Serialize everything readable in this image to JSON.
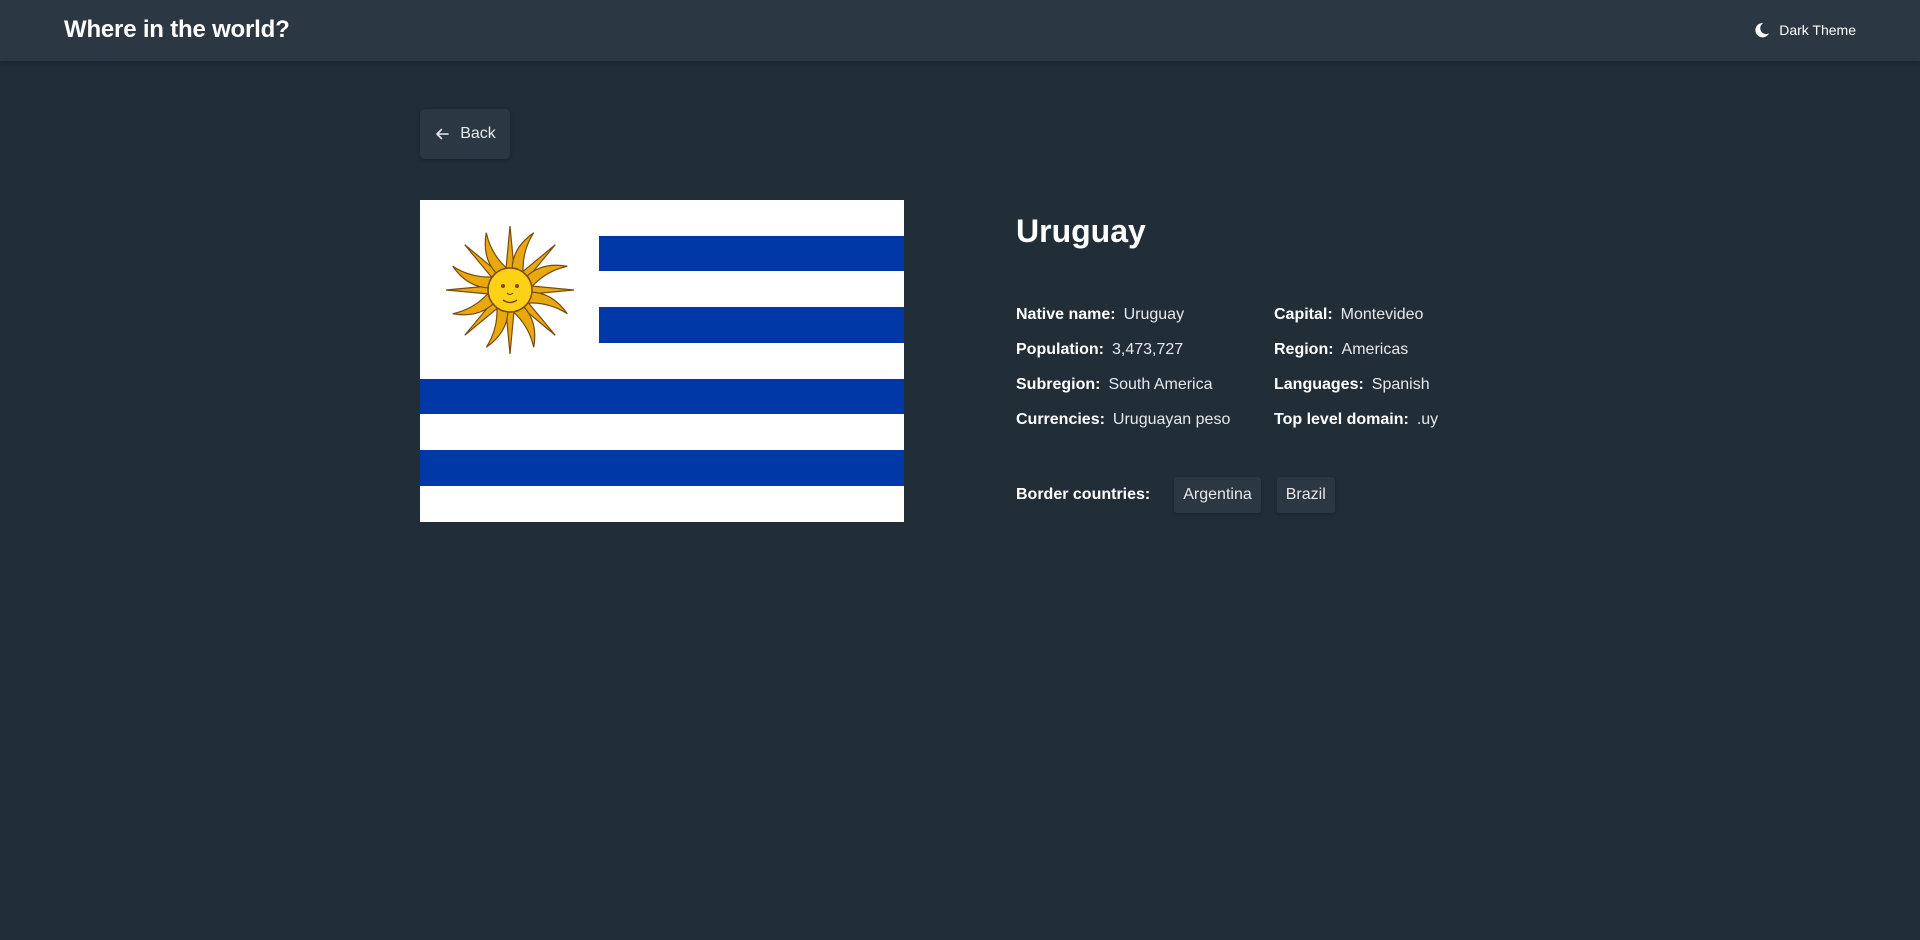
{
  "header": {
    "title": "Where in the world?",
    "theme_toggle_label": "Dark Theme",
    "theme_icon": "moon-icon"
  },
  "back_button": {
    "label": "Back",
    "icon": "arrow-left-icon"
  },
  "country": {
    "name": "Uruguay",
    "flag_alt": "Uruguay",
    "details_left": [
      {
        "label": "Native name:",
        "value": "Uruguay"
      },
      {
        "label": "Population:",
        "value": "3,473,727"
      },
      {
        "label": "Subregion:",
        "value": "South America"
      },
      {
        "label": "Currencies:",
        "value": "Uruguayan peso"
      }
    ],
    "details_right": [
      {
        "label": "Capital:",
        "value": "Montevideo"
      },
      {
        "label": "Region:",
        "value": "Americas"
      },
      {
        "label": "Languages:",
        "value": "Spanish"
      },
      {
        "label": "Top level domain:",
        "value": ".uy"
      }
    ],
    "border_countries_label": "Border countries:",
    "border_countries": [
      "Argentina",
      "Brazil"
    ]
  },
  "colors": {
    "background": "#212e37",
    "surface": "#2b3743",
    "text": "#ffffff",
    "flag_blue": "#0038a8",
    "flag_sun": "#fcd116"
  }
}
